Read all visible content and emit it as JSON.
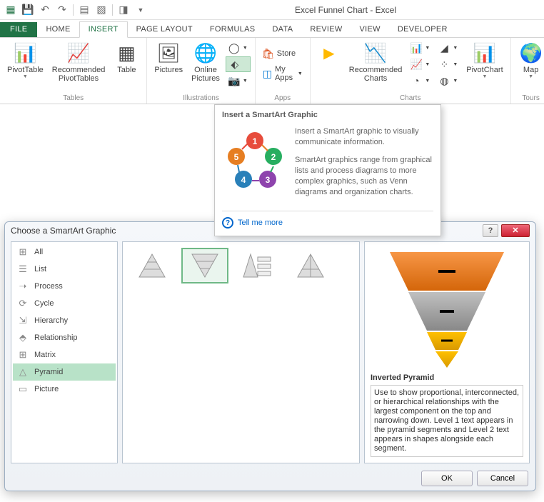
{
  "titlebar": {
    "text": "Excel Funnel Chart - Excel"
  },
  "tabs": [
    "FILE",
    "HOME",
    "INSERT",
    "PAGE LAYOUT",
    "FORMULAS",
    "DATA",
    "REVIEW",
    "VIEW",
    "DEVELOPER"
  ],
  "active_tab": "INSERT",
  "groups": {
    "tables": {
      "label": "Tables",
      "pivottable": "PivotTable",
      "recommended_pivot": "Recommended\nPivotTables",
      "table": "Table"
    },
    "illustrations": {
      "label": "Illustrations",
      "pictures": "Pictures",
      "online_pictures": "Online\nPictures"
    },
    "apps": {
      "label": "Apps",
      "store": "Store",
      "myapps": "My Apps"
    },
    "charts": {
      "label": "Charts",
      "recommended": "Recommended\nCharts",
      "pivotchart": "PivotChart"
    },
    "tours": {
      "label": "Tours",
      "map": "Map"
    }
  },
  "tooltip": {
    "title": "Insert a SmartArt Graphic",
    "p1": "Insert a SmartArt graphic to visually communicate information.",
    "p2": "SmartArt graphics range from graphical lists and process diagrams to more complex graphics, such as Venn diagrams and organization charts.",
    "more": "Tell me more"
  },
  "dialog": {
    "title": "Choose a SmartArt Graphic",
    "categories": [
      "All",
      "List",
      "Process",
      "Cycle",
      "Hierarchy",
      "Relationship",
      "Matrix",
      "Pyramid",
      "Picture"
    ],
    "selected_category": "Pyramid",
    "preview": {
      "title": "Inverted Pyramid",
      "desc": "Use to show proportional, interconnected, or hierarchical relationships with the largest component on the top and narrowing down. Level 1 text appears in the pyramid segments and Level 2 text appears in shapes alongside each segment."
    },
    "ok": "OK",
    "cancel": "Cancel"
  }
}
